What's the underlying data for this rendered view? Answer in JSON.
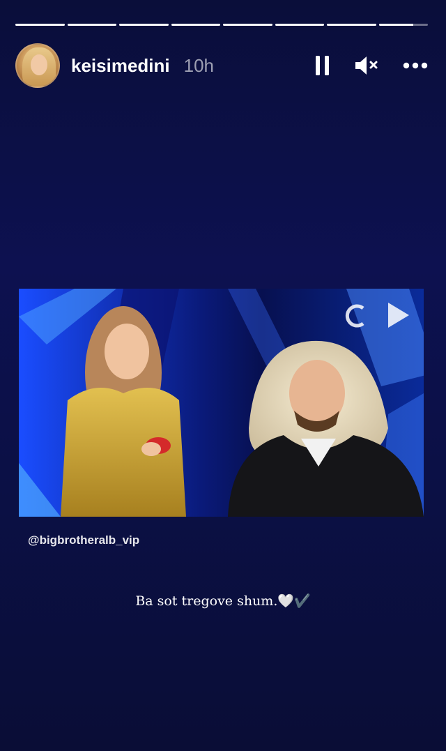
{
  "story": {
    "segments_total": 8,
    "segments_complete": 7,
    "current_segment_progress": 0.7
  },
  "header": {
    "username": "keisimedini",
    "time_ago": "10h",
    "pause_icon": "pause-icon",
    "mute_icon": "muted-speaker-icon",
    "more_icon": "more-options-icon"
  },
  "media": {
    "tag_handle": "@bigbrotheralb_vip",
    "colors": {
      "accent": "#2a63ff",
      "gold": "#c9a235",
      "jacket": "#151518"
    }
  },
  "text_overlay": {
    "text": "Ba sot tregove shum.🤍✔️"
  }
}
